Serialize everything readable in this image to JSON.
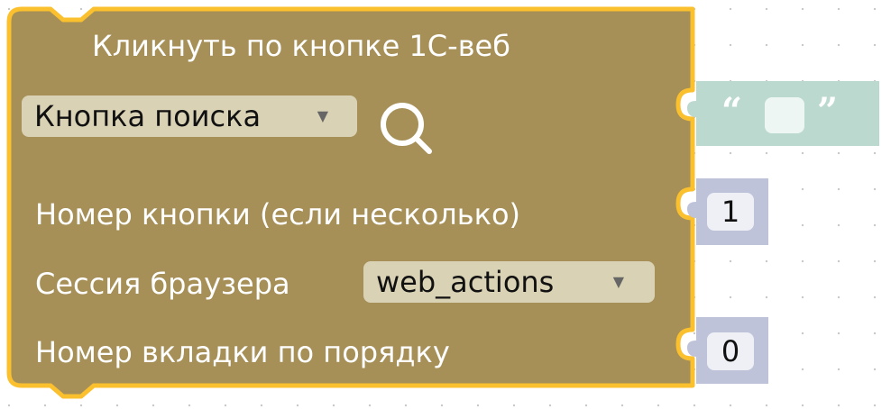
{
  "block": {
    "title": "Кликнуть по кнопке 1С-веб",
    "button_type_dropdown": {
      "selected": "Кнопка поиска"
    },
    "search_icon": "search-icon",
    "fields": {
      "button_number_label": "Номер кнопки (если несколько)",
      "browser_session_label": "Сессия браузера",
      "tab_number_label": "Номер вкладки по порядку"
    },
    "session_dropdown": {
      "selected": "web_actions"
    }
  },
  "inputs": {
    "string_value": "",
    "button_number_value": "1",
    "tab_number_value": "0"
  },
  "colors": {
    "block": "#a69058",
    "block_outline": "#fbc02d",
    "dropdown_bg": "#d9d2b5",
    "string_block": "#bcd9cf",
    "number_block": "#bfc3d9"
  }
}
